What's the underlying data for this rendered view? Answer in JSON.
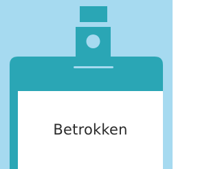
{
  "badge": {
    "label": "Betrokken",
    "icon": "id-badge-icon"
  },
  "colors": {
    "background": "#a6daf0",
    "badge": "#2aa6b5",
    "card": "#ffffff",
    "text": "#2b2b2b"
  }
}
